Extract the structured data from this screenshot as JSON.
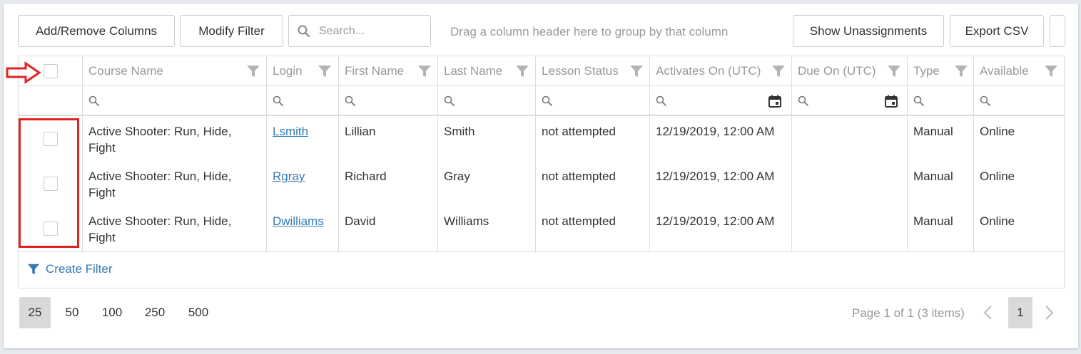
{
  "toolbar": {
    "add_remove_columns": "Add/Remove Columns",
    "modify_filter": "Modify Filter",
    "search_placeholder": "Search...",
    "group_hint": "Drag a column header here to group by that column",
    "show_unassignments": "Show Unassignments",
    "export_csv": "Export CSV"
  },
  "columns": {
    "course_name": "Course Name",
    "login": "Login",
    "first_name": "First Name",
    "last_name": "Last Name",
    "lesson_status": "Lesson Status",
    "activates_on": "Activates On (UTC)",
    "due_on": "Due On (UTC)",
    "type": "Type",
    "available": "Available"
  },
  "rows": [
    {
      "course_line1": "Active Shooter: Run, Hide,",
      "course_line2": "Fight",
      "login": "Lsmith",
      "first_name": "Lillian",
      "last_name": "Smith",
      "lesson_status": "not attempted",
      "activates_on": "12/19/2019, 12:00 AM",
      "due_on": "",
      "type": "Manual",
      "available": "Online"
    },
    {
      "course_line1": "Active Shooter: Run, Hide,",
      "course_line2": "Fight",
      "login": "Rgray",
      "first_name": "Richard",
      "last_name": "Gray",
      "lesson_status": "not attempted",
      "activates_on": "12/19/2019, 12:00 AM",
      "due_on": "",
      "type": "Manual",
      "available": "Online"
    },
    {
      "course_line1": "Active Shooter: Run, Hide,",
      "course_line2": "Fight",
      "login": "Dwilliams",
      "first_name": "David",
      "last_name": "Williams",
      "lesson_status": "not attempted",
      "activates_on": "12/19/2019, 12:00 AM",
      "due_on": "",
      "type": "Manual",
      "available": "Online"
    }
  ],
  "footer": {
    "create_filter": "Create Filter"
  },
  "pager": {
    "page_sizes": [
      "25",
      "50",
      "100",
      "250",
      "500"
    ],
    "selected_page_size": "25",
    "info": "Page 1 of 1 (3 items)",
    "current_page": "1"
  },
  "colors": {
    "link": "#337ab7",
    "annotation": "#e32222",
    "header_text": "#999999"
  },
  "icons": {
    "search": "search-icon",
    "column_filter": "funnel-icon",
    "calendar": "calendar-icon",
    "prev": "chevron-left-icon",
    "next": "chevron-right-icon",
    "annotation_arrow": "arrow-right-icon"
  }
}
